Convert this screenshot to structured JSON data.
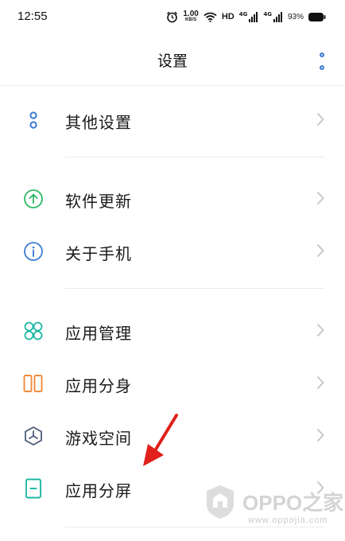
{
  "status_bar": {
    "time": "12:55",
    "speed_value": "1.00",
    "speed_unit": "KB/S",
    "hd_label": "HD",
    "network_type_1": "4G",
    "network_type_2": "4G",
    "battery_percent": "93%"
  },
  "header": {
    "title": "设置"
  },
  "menu": {
    "other_settings": {
      "label": "其他设置",
      "icon": "two-circles-icon",
      "color": "#3a7bd5"
    },
    "software_update": {
      "label": "软件更新",
      "icon": "arrow-up-circle-icon",
      "color": "#2cba66"
    },
    "about_phone": {
      "label": "关于手机",
      "icon": "info-circle-icon",
      "color": "#3a7bd5"
    },
    "app_management": {
      "label": "应用管理",
      "icon": "app-grid-icon",
      "color": "#1db8a4"
    },
    "app_clone": {
      "label": "应用分身",
      "icon": "clone-icon",
      "color": "#f08a3e"
    },
    "game_space": {
      "label": "游戏空间",
      "icon": "game-space-icon",
      "color": "#4a5a78"
    },
    "split_screen": {
      "label": "应用分屏",
      "icon": "split-screen-icon",
      "color": "#1db8a4"
    }
  },
  "watermark": {
    "brand": "OPPO之家",
    "url": "www.oppojia.com"
  },
  "annotation": {
    "arrow_color": "#e0201b"
  }
}
